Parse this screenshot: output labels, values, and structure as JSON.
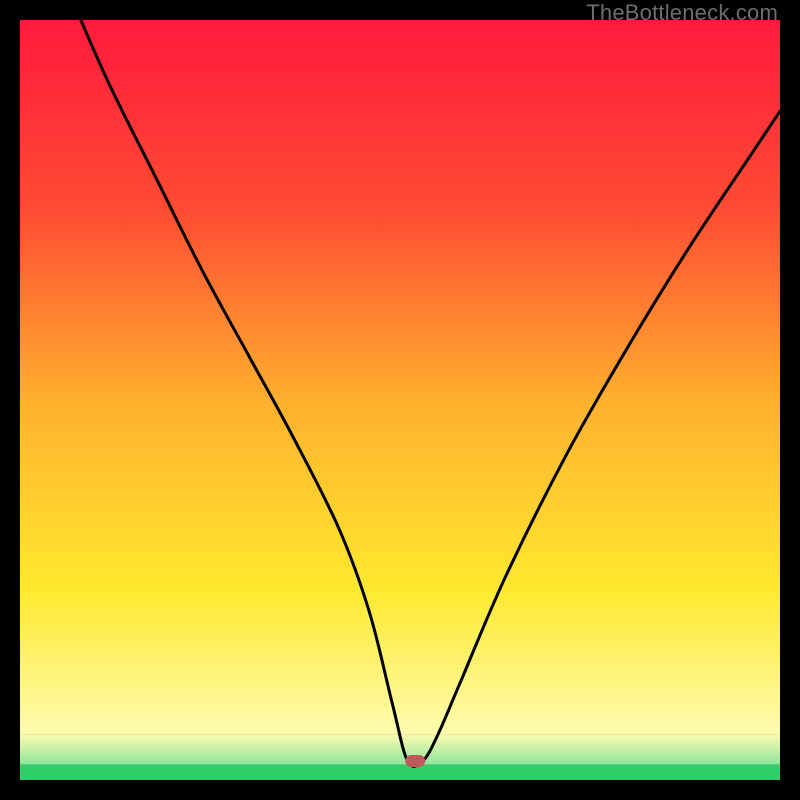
{
  "watermark": "TheBottleneck.com",
  "chart_data": {
    "type": "line",
    "title": "",
    "xlabel": "",
    "ylabel": "",
    "xlim": [
      0,
      100
    ],
    "ylim": [
      0,
      100
    ],
    "grid": false,
    "legend": false,
    "series": [
      {
        "name": "curve",
        "x": [
          8,
          12,
          18,
          24,
          30,
          36,
          42,
          46,
          49,
          51,
          53,
          55,
          58,
          64,
          72,
          80,
          88,
          96,
          100
        ],
        "values": [
          100,
          91,
          79,
          67,
          56,
          45,
          33,
          22,
          10,
          2.5,
          2.5,
          6,
          13,
          27,
          43,
          57,
          70,
          82,
          88
        ]
      }
    ],
    "marker": {
      "x": 52,
      "y": 2.5,
      "color": "#c05a5a"
    },
    "bands": [
      {
        "y0": 75,
        "y1": 100,
        "stops": [
          [
            "0%",
            "#ff1a3d"
          ],
          [
            "100%",
            "#ff4b33"
          ]
        ]
      },
      {
        "y0": 25,
        "y1": 75,
        "stops": [
          [
            "0%",
            "#ff4b33"
          ],
          [
            "50%",
            "#ffb02e"
          ],
          [
            "100%",
            "#ffe92e"
          ]
        ]
      },
      {
        "y0": 6,
        "y1": 25,
        "stops": [
          [
            "0%",
            "#ffe92e"
          ],
          [
            "100%",
            "#fdfcb0"
          ]
        ]
      },
      {
        "y0": 2,
        "y1": 6,
        "stops": [
          [
            "0%",
            "#fdfcb0"
          ],
          [
            "100%",
            "#8ee59c"
          ]
        ]
      },
      {
        "y0": 0,
        "y1": 2,
        "stops": [
          [
            "0%",
            "#2fd06a"
          ],
          [
            "100%",
            "#2fd06a"
          ]
        ]
      }
    ]
  }
}
